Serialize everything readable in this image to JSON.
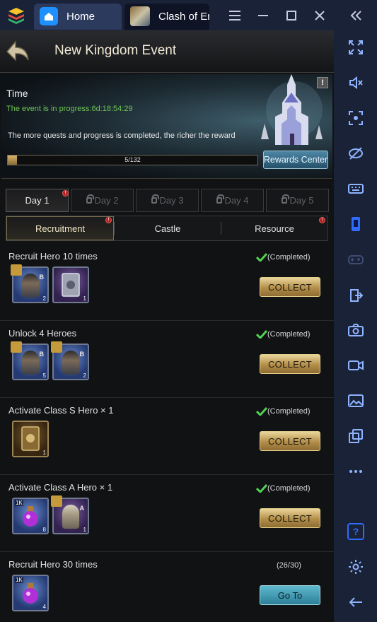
{
  "app": {
    "tabs": [
      {
        "label": "Home"
      },
      {
        "label": "Clash of Em"
      }
    ]
  },
  "header": {
    "title": "New Kingdom Event"
  },
  "banner": {
    "time_label": "Time",
    "progress_text": "The event is in progress:6d:18:54:29",
    "reward_text": "The more quests and progress is completed, the richer the reward",
    "progress_label": "5/132",
    "progress_value": 5,
    "progress_max": 132,
    "rewards_button": "Rewards Center"
  },
  "day_tabs": [
    {
      "label": "Day 1",
      "active": true,
      "locked": false
    },
    {
      "label": "Day 2",
      "active": false,
      "locked": true
    },
    {
      "label": "Day 3",
      "active": false,
      "locked": true
    },
    {
      "label": "Day 4",
      "active": false,
      "locked": true
    },
    {
      "label": "Day 5",
      "active": false,
      "locked": true
    }
  ],
  "sub_tabs": [
    {
      "label": "Recruitment",
      "active": true
    },
    {
      "label": "Castle",
      "active": false
    },
    {
      "label": "Resource",
      "active": false
    }
  ],
  "quests": [
    {
      "title": "Recruit Hero 10 times",
      "status": "(Completed)",
      "button": "COLLECT",
      "items": [
        {
          "kind": "hero-fragment",
          "grade": "B",
          "count": "2"
        },
        {
          "kind": "card",
          "count": "1"
        }
      ]
    },
    {
      "title": "Unlock 4 Heroes",
      "status": "(Completed)",
      "button": "COLLECT",
      "items": [
        {
          "kind": "hero-fragment",
          "grade": "B",
          "count": "5"
        },
        {
          "kind": "hero-fragment",
          "grade": "B",
          "count": "2"
        }
      ]
    },
    {
      "title": "Activate Class S Hero × 1",
      "status": "(Completed)",
      "button": "COLLECT",
      "items": [
        {
          "kind": "gold-card",
          "count": "1"
        }
      ]
    },
    {
      "title": "Activate Class A Hero × 1",
      "status": "(Completed)",
      "button": "COLLECT",
      "items": [
        {
          "kind": "potion",
          "tag": "1K",
          "count": "8"
        },
        {
          "kind": "hero-fragment",
          "grade": "A",
          "count": "1"
        }
      ]
    },
    {
      "title": "Recruit Hero 30 times",
      "status": "(26/30)",
      "button": "Go To",
      "items": [
        {
          "kind": "potion",
          "tag": "1K",
          "count": "4"
        }
      ]
    }
  ],
  "icons": {
    "window": [
      "menu-icon",
      "minimize-icon",
      "maximize-icon",
      "close-icon",
      "collapse-icon"
    ],
    "sidebar": [
      "fullscreen-icon",
      "mute-icon",
      "screenshot-area-icon",
      "eye-off-icon",
      "keyboard-icon",
      "phone-icon",
      "gamepad-icon",
      "install-apk-icon",
      "camera-icon",
      "record-icon",
      "gallery-icon",
      "multi-instance-icon",
      "more-icon",
      "help-icon",
      "settings-icon",
      "back-icon"
    ]
  },
  "colors": {
    "accent_green": "#6fc357",
    "button_gold": "#b38e49",
    "button_teal": "#2c7f97",
    "sidebar_bg": "#1a2238"
  }
}
